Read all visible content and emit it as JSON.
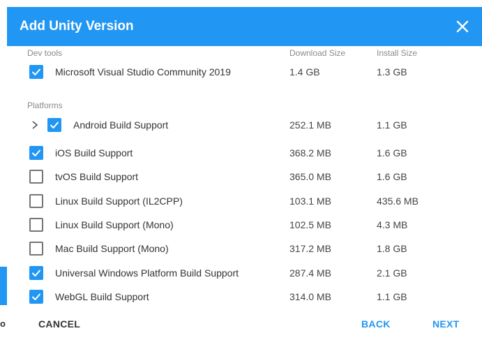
{
  "background": {
    "glyph": "o",
    "accent_color": "#2196f3"
  },
  "dialog": {
    "title": "Add Unity Version",
    "header_color": "#2196f3",
    "close_icon": "close-icon"
  },
  "columns": {
    "download": "Download Size",
    "install": "Install Size"
  },
  "sections": {
    "dev_tools": "Dev tools",
    "platforms": "Platforms"
  },
  "dev_tools_items": [
    {
      "label": "Microsoft Visual Studio Community 2019",
      "download": "1.4 GB",
      "install": "1.3 GB",
      "checked": true
    }
  ],
  "platform_items": [
    {
      "label": "Android Build Support",
      "download": "252.1 MB",
      "install": "1.1 GB",
      "checked": true,
      "expandable": true
    },
    {
      "label": "iOS Build Support",
      "download": "368.2 MB",
      "install": "1.6 GB",
      "checked": true
    },
    {
      "label": "tvOS Build Support",
      "download": "365.0 MB",
      "install": "1.6 GB",
      "checked": false
    },
    {
      "label": "Linux Build Support (IL2CPP)",
      "download": "103.1 MB",
      "install": "435.6 MB",
      "checked": false
    },
    {
      "label": "Linux Build Support (Mono)",
      "download": "102.5 MB",
      "install": "4.3 MB",
      "checked": false
    },
    {
      "label": "Mac Build Support (Mono)",
      "download": "317.2 MB",
      "install": "1.8 GB",
      "checked": false
    },
    {
      "label": "Universal Windows Platform Build Support",
      "download": "287.4 MB",
      "install": "2.1 GB",
      "checked": true
    },
    {
      "label": "WebGL Build Support",
      "download": "314.0 MB",
      "install": "1.1 GB",
      "checked": true
    }
  ],
  "footer": {
    "cancel": "CANCEL",
    "back": "BACK",
    "next": "NEXT"
  }
}
